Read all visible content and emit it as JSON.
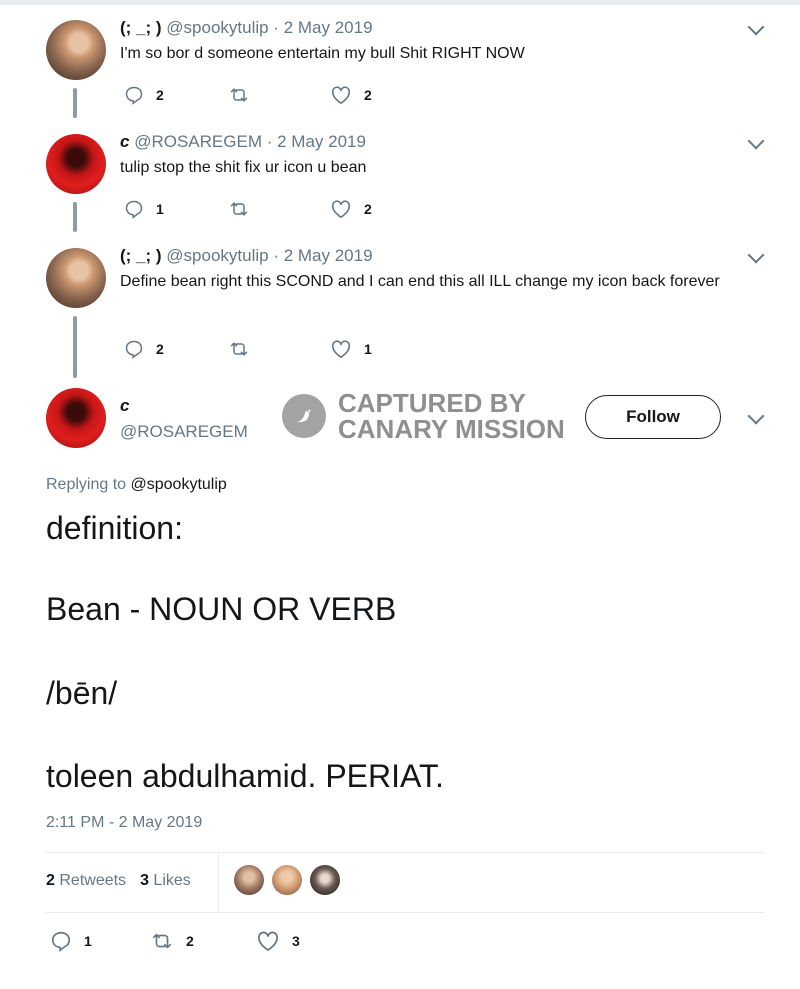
{
  "tweets": [
    {
      "display_name": "(;  _;  )",
      "handle": "@spookytulip",
      "date": "· 2 May 2019",
      "text": "I'm so bor d someone entertain my bull Shit RIGHT NOW",
      "replies": "2",
      "retweets": "",
      "likes": "2"
    },
    {
      "display_name": "c",
      "handle": "@ROSAREGEM",
      "date": "· 2 May 2019",
      "text": "tulip stop the shit fix ur icon u bean",
      "replies": "1",
      "retweets": "",
      "likes": "2"
    },
    {
      "display_name": "(;  _;  )",
      "handle": "@spookytulip",
      "date": "· 2 May 2019",
      "text": "Define bean right this SCOND and I can end this all ILL change my icon back forever",
      "replies": "2",
      "retweets": "",
      "likes": "1"
    }
  ],
  "main": {
    "display_name": "c",
    "handle": "@ROSAREGEM",
    "follow_label": "Follow",
    "replying_prefix": "Replying to",
    "replying_handle": "@spookytulip",
    "lines": [
      "definition:",
      "Bean - NOUN OR VERB",
      "/bēn/",
      "toleen abdulhamid. PERIAT."
    ],
    "timestamp": "2:11 PM - 2 May 2019",
    "retweet_count": "2",
    "retweet_label": "Retweets",
    "like_count": "3",
    "like_label": "Likes",
    "actions": {
      "replies": "1",
      "retweets": "2",
      "likes": "3"
    }
  },
  "watermark": {
    "line1": "CAPTURED BY",
    "line2": "CANARY MISSION"
  },
  "icons": [
    "reply-icon",
    "retweet-icon",
    "like-icon",
    "chevron-down-icon",
    "canary-logo-icon"
  ],
  "colors": {
    "secondary_text": "#657786",
    "divider": "#e6ecf0",
    "thread_line": "#8e9aa4"
  }
}
